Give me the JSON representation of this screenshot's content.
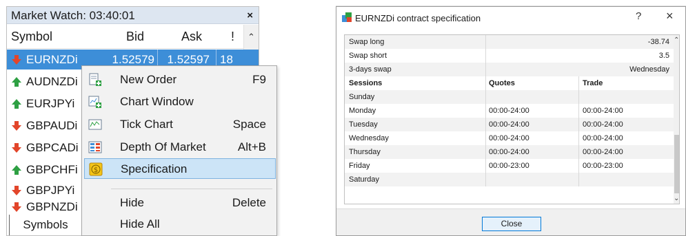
{
  "market_watch": {
    "title": "Market Watch: 03:40:01",
    "close_glyph": "×",
    "columns": {
      "symbol": "Symbol",
      "bid": "Bid",
      "ask": "Ask",
      "spread": "!"
    },
    "rows": [
      {
        "symbol": "EURNZDi",
        "bid": "1.52579",
        "ask": "1.52597",
        "spread": "18",
        "direction": "down",
        "selected": true
      },
      {
        "symbol": "AUDNZDi",
        "direction": "up"
      },
      {
        "symbol": "EURJPYi",
        "direction": "up"
      },
      {
        "symbol": "GBPAUDi",
        "direction": "down"
      },
      {
        "symbol": "GBPCADi",
        "direction": "down"
      },
      {
        "symbol": "GBPCHFi",
        "direction": "up"
      },
      {
        "symbol": "GBPJPYi",
        "direction": "down"
      },
      {
        "symbol": "GBPNZDi",
        "direction": "down"
      }
    ],
    "tab_label": "Symbols"
  },
  "context_menu": {
    "items": [
      {
        "label": "New Order",
        "shortcut": "F9",
        "icon": "new-order-icon"
      },
      {
        "label": "Chart Window",
        "shortcut": "",
        "icon": "chart-window-icon"
      },
      {
        "label": "Tick Chart",
        "shortcut": "Space",
        "icon": "tick-chart-icon"
      },
      {
        "label": "Depth Of Market",
        "shortcut": "Alt+B",
        "icon": "depth-of-market-icon"
      },
      {
        "label": "Specification",
        "shortcut": "",
        "icon": "specification-icon",
        "highlighted": true
      },
      {
        "label": "Hide",
        "shortcut": "Delete"
      },
      {
        "label": "Hide All",
        "shortcut": ""
      }
    ]
  },
  "dialog": {
    "title": "EURNZDi contract specification",
    "help_glyph": "?",
    "close_glyph": "×",
    "rows": [
      {
        "name": "Swap long",
        "value": "-38.74"
      },
      {
        "name": "Swap short",
        "value": "3.5"
      },
      {
        "name": "3-days swap",
        "value": "Wednesday"
      }
    ],
    "sessions_header": {
      "c1": "Sessions",
      "c2": "Quotes",
      "c3": "Trade"
    },
    "sessions": [
      {
        "day": "Sunday",
        "quotes": "",
        "trade": ""
      },
      {
        "day": "Monday",
        "quotes": "00:00-24:00",
        "trade": "00:00-24:00"
      },
      {
        "day": "Tuesday",
        "quotes": "00:00-24:00",
        "trade": "00:00-24:00"
      },
      {
        "day": "Wednesday",
        "quotes": "00:00-24:00",
        "trade": "00:00-24:00"
      },
      {
        "day": "Thursday",
        "quotes": "00:00-24:00",
        "trade": "00:00-24:00"
      },
      {
        "day": "Friday",
        "quotes": "00:00-23:00",
        "trade": "00:00-23:00"
      },
      {
        "day": "Saturday",
        "quotes": "",
        "trade": ""
      }
    ],
    "close_label": "Close"
  },
  "colors": {
    "selection": "#3d8ed8",
    "up": "#2ea043",
    "down": "#e2452a",
    "menu_highlight": "#cce4f7"
  }
}
